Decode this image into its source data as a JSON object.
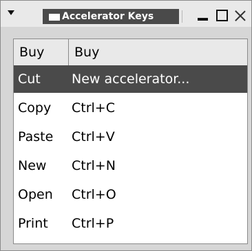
{
  "window": {
    "title": "Accelerator Keys"
  },
  "table": {
    "columns": [
      "Buy",
      "Buy"
    ],
    "rows": [
      {
        "action": "Cut",
        "accel": "New accelerator..."
      },
      {
        "action": "Copy",
        "accel": "Ctrl+C"
      },
      {
        "action": "Paste",
        "accel": "Ctrl+V"
      },
      {
        "action": "New",
        "accel": "Ctrl+N"
      },
      {
        "action": "Open",
        "accel": "Ctrl+O"
      },
      {
        "action": "Print",
        "accel": "Ctrl+P"
      }
    ],
    "selected_index": 0
  },
  "colors": {
    "selection": "#4a4a4a",
    "window_bg": "#d6d6d6",
    "titlebar_bg": "#e9e9e9"
  },
  "icons": {
    "window_menu": "menu-arrow-icon",
    "app": "window-app-icon",
    "minimize": "minimize-icon",
    "maximize": "maximize-icon",
    "close": "close-icon"
  }
}
